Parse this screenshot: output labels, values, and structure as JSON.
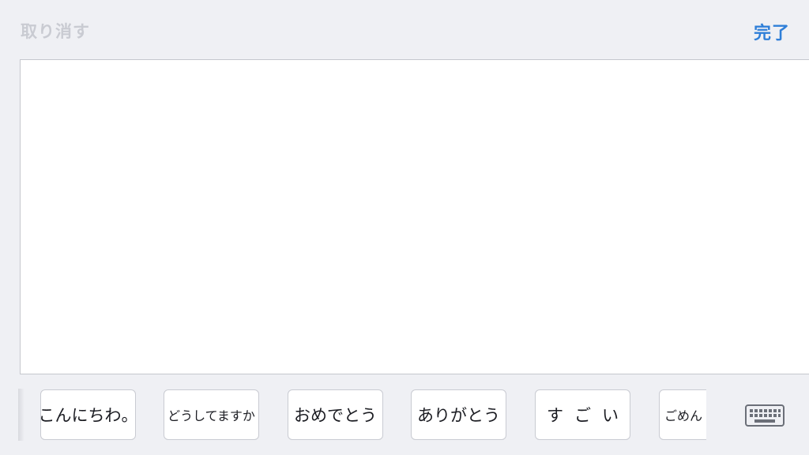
{
  "toolbar": {
    "undo_label": "取り消す",
    "done_label": "完了"
  },
  "canvas": {
    "label": ""
  },
  "phrases": [
    {
      "text": "こんにちわ。"
    },
    {
      "text": "どうしてますか"
    },
    {
      "text": "おめでとう"
    },
    {
      "text": "ありがとう"
    },
    {
      "text": "すごい"
    },
    {
      "text": "ごめん"
    }
  ],
  "keyboard": {
    "icon": "keyboard-icon"
  },
  "colors": {
    "background": "#eff0f4",
    "accent": "#2f7fd8",
    "disabled": "#c9cbd2"
  }
}
